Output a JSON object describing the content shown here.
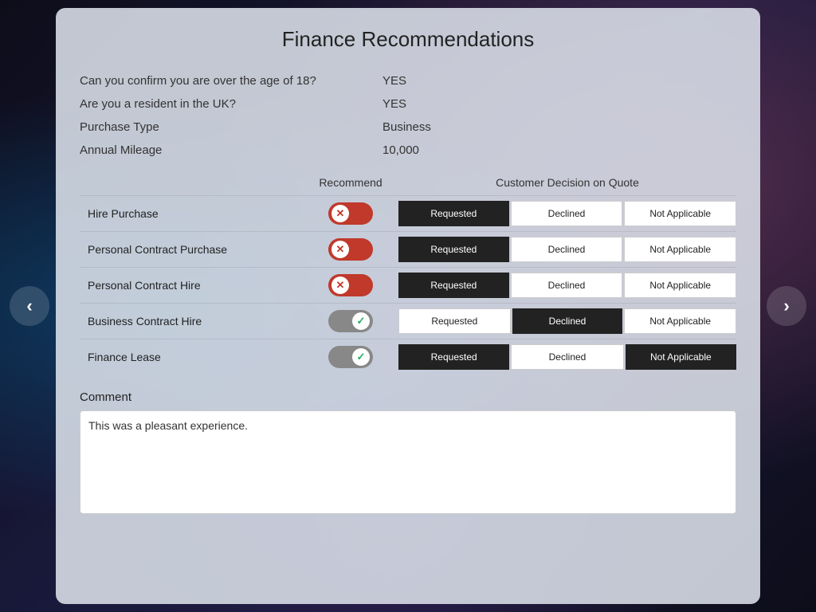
{
  "page": {
    "title": "Finance Recommendations",
    "nav": {
      "left_arrow": "‹",
      "right_arrow": "›",
      "check_mark": "✔"
    }
  },
  "info_rows": [
    {
      "label": "Can you confirm you are over the age of 18?",
      "value": "YES"
    },
    {
      "label": "Are you a resident in the UK?",
      "value": "YES"
    },
    {
      "label": "Purchase Type",
      "value": "Business"
    },
    {
      "label": "Annual Mileage",
      "value": "10,000"
    }
  ],
  "table_headers": {
    "recommend": "Recommend",
    "decision": "Customer Decision on Quote"
  },
  "recommendation_rows": [
    {
      "label": "Hire Purchase",
      "toggle_state": "off",
      "decisions": {
        "requested": {
          "label": "Requested",
          "active": true
        },
        "declined": {
          "label": "Declined",
          "active": false
        },
        "na": {
          "label": "Not Applicable",
          "active": false
        }
      }
    },
    {
      "label": "Personal Contract Purchase",
      "toggle_state": "off",
      "decisions": {
        "requested": {
          "label": "Requested",
          "active": true
        },
        "declined": {
          "label": "Declined",
          "active": false
        },
        "na": {
          "label": "Not Applicable",
          "active": false
        }
      }
    },
    {
      "label": "Personal Contract Hire",
      "toggle_state": "off",
      "decisions": {
        "requested": {
          "label": "Requested",
          "active": true
        },
        "declined": {
          "label": "Declined",
          "active": false
        },
        "na": {
          "label": "Not Applicable",
          "active": false
        }
      }
    },
    {
      "label": "Business Contract Hire",
      "toggle_state": "on",
      "decisions": {
        "requested": {
          "label": "Requested",
          "active": false
        },
        "declined": {
          "label": "Declined",
          "active": true
        },
        "na": {
          "label": "Not Applicable",
          "active": false
        }
      }
    },
    {
      "label": "Finance Lease",
      "toggle_state": "on",
      "decisions": {
        "requested": {
          "label": "Requested",
          "active": true
        },
        "declined": {
          "label": "Declined",
          "active": false
        },
        "na": {
          "label": "Not Applicable",
          "active": true
        }
      }
    }
  ],
  "comment": {
    "label": "Comment",
    "value": "This was a pleasant experience."
  }
}
